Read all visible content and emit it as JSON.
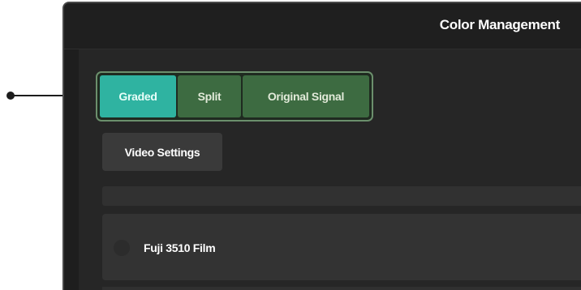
{
  "window": {
    "title": "Color Management"
  },
  "view_mode": {
    "options": [
      {
        "label": "Graded",
        "active": true
      },
      {
        "label": "Split",
        "active": false
      },
      {
        "label": "Original Signal",
        "active": false
      }
    ]
  },
  "video_settings": {
    "label": "Video Settings"
  },
  "presets": [
    {
      "label": "Fuji 3510 Film"
    }
  ],
  "colors": {
    "active_segment": "#2fb3a1",
    "inactive_segment": "#3d6b41",
    "segment_border": "#6b8f6c",
    "panel_bg": "#262626"
  }
}
